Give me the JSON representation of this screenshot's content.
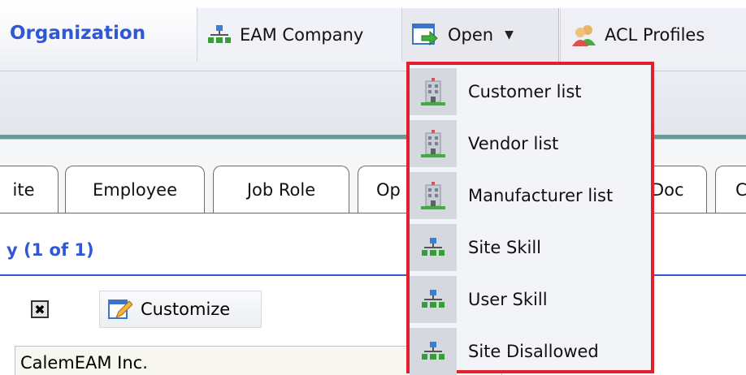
{
  "toolbar": {
    "section_title": "Organization",
    "eam_company_label": "EAM Company",
    "open_label": "Open",
    "acl_profiles_label": "ACL Profiles"
  },
  "tabs": [
    {
      "label": "ite"
    },
    {
      "label": "Employee"
    },
    {
      "label": "Job Role"
    },
    {
      "label": "Op"
    },
    {
      "label": "Doc"
    },
    {
      "label": "C"
    }
  ],
  "list": {
    "count_text": "y (1 of 1)",
    "customize_label": "Customize",
    "close_glyph": "✖",
    "first_row_value": "CalemEAM Inc."
  },
  "open_menu": {
    "items": [
      {
        "label": "Customer list",
        "icon": "building-icon"
      },
      {
        "label": "Vendor list",
        "icon": "building-icon"
      },
      {
        "label": "Manufacturer list",
        "icon": "building-icon"
      },
      {
        "label": "Site Skill",
        "icon": "org-chart-icon"
      },
      {
        "label": "User Skill",
        "icon": "org-chart-icon"
      },
      {
        "label": "Site Disallowed",
        "icon": "org-chart-icon"
      }
    ]
  },
  "colors": {
    "accent_blue": "#2f57d6",
    "highlight_red": "#e0202c",
    "tab_bar_teal": "#6c9a98"
  }
}
